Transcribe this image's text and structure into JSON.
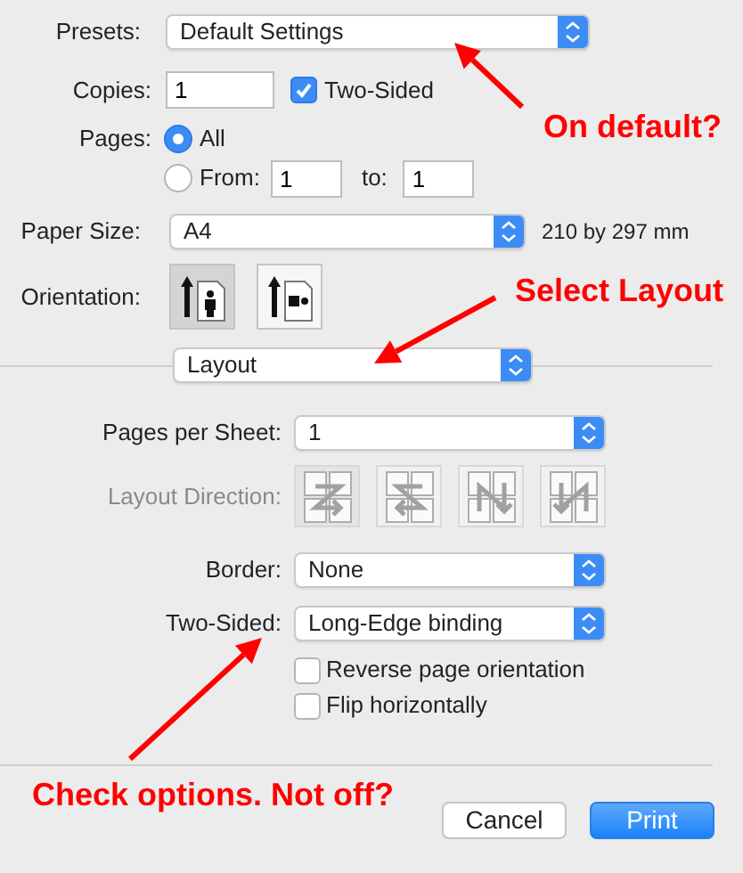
{
  "presets": {
    "label": "Presets:",
    "value": "Default Settings"
  },
  "copies": {
    "label": "Copies:",
    "value": "1"
  },
  "two_sided": {
    "label": "Two-Sided",
    "checked": true
  },
  "pages": {
    "label": "Pages:",
    "options": [
      {
        "label": "All",
        "selected": true
      },
      {
        "label": "From:",
        "selected": false
      }
    ],
    "from": "1",
    "to_label": "to:",
    "to": "1"
  },
  "paper_size": {
    "label": "Paper Size:",
    "value": "A4",
    "dimensions": "210 by 297 mm"
  },
  "orientation": {
    "label": "Orientation:",
    "options": [
      {
        "kind": "portrait",
        "selected": true
      },
      {
        "kind": "landscape",
        "selected": false
      }
    ]
  },
  "section_menu": {
    "value": "Layout"
  },
  "layout": {
    "pages_per_sheet": {
      "label": "Pages per Sheet:",
      "value": "1"
    },
    "layout_direction": {
      "label": "Layout Direction:",
      "disabled": true,
      "options": [
        {
          "kind": "z",
          "selected": true
        },
        {
          "kind": "s",
          "selected": false
        },
        {
          "kind": "n_reverse",
          "selected": false
        },
        {
          "kind": "n",
          "selected": false
        }
      ]
    },
    "border": {
      "label": "Border:",
      "value": "None"
    },
    "two_sided": {
      "label": "Two-Sided:",
      "value": "Long-Edge binding"
    },
    "options": [
      {
        "label": "Reverse page orientation",
        "checked": false
      },
      {
        "label": "Flip horizontally",
        "checked": false
      }
    ]
  },
  "buttons": [
    {
      "label": "Cancel",
      "kind": "default"
    },
    {
      "label": "Print",
      "kind": "primary"
    }
  ],
  "annotations": [
    {
      "text": "On default?",
      "kind": "top"
    },
    {
      "text": "Select Layout",
      "kind": "middle"
    },
    {
      "text": "Check options. Not off?",
      "kind": "bottom"
    }
  ]
}
